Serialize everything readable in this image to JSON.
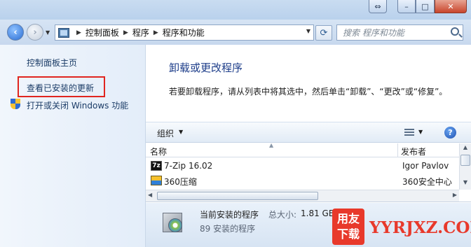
{
  "window": {
    "caption_expand": "⇔",
    "caption_minimize": "–",
    "caption_maximize": "□",
    "caption_close": "✕"
  },
  "address_bar": {
    "breadcrumbs": [
      "控制面板",
      "程序",
      "程序和功能"
    ],
    "search_placeholder": "搜索 程序和功能"
  },
  "left_pane": {
    "home_link": "控制面板主页",
    "updates_link": "查看已安装的更新",
    "features_link": "打开或关闭 Windows 功能",
    "highlight_color": "#e0251f"
  },
  "main": {
    "title": "卸载或更改程序",
    "description": "若要卸载程序，请从列表中将其选中，然后单击“卸载”、“更改”或“修复”。"
  },
  "toolbar": {
    "organize_label": "组织",
    "help_label": "?"
  },
  "program_list": {
    "columns": [
      "名称",
      "发布者"
    ],
    "rows": [
      {
        "icon": "7zip-icon",
        "icon_text": "7z",
        "name": "7-Zip 16.02",
        "publisher": "Igor Pavlov"
      },
      {
        "icon": "360-compress-icon",
        "icon_text": "",
        "name": "360压缩",
        "publisher": "360安全中心"
      }
    ]
  },
  "status_bar": {
    "label": "当前安装的程序",
    "size_label": "总大小:",
    "size_value": "1.81 GB",
    "count_text": "89 安装的程序"
  },
  "watermark": {
    "logo_top": "用友",
    "logo_bottom": "下载",
    "text": "YYRJXZ.COM",
    "color": "#e8392b"
  }
}
